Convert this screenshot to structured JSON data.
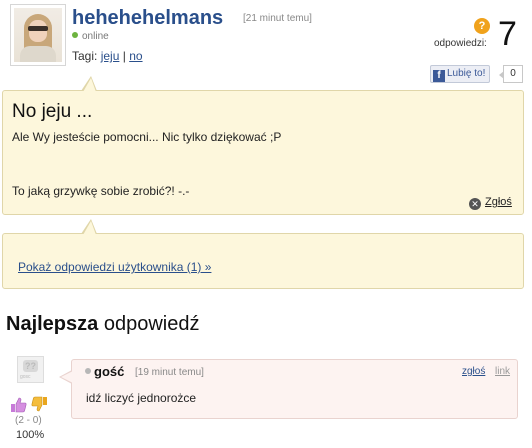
{
  "question": {
    "username": "hehehehelmans",
    "time": "[21 minut temu]",
    "status": "online",
    "tags_label": "Tagi:",
    "tags": [
      "jeju",
      "no"
    ],
    "tags_sep": " | ",
    "answers_label": "odpowiedzi:",
    "answers_count": "7",
    "q_icon": "?",
    "fb_like_label": "Lubię to!",
    "fb_like_count": "0",
    "title": "No jeju ...",
    "line1": "Ale Wy jesteście pomocni... Nic tylko dziękować ;P",
    "line2": "To jaką grzywkę sobie zrobić?! -.-",
    "report_label": "Zgłoś"
  },
  "user_answers": {
    "link_label": "Pokaż odpowiedzi użytkownika (1) »"
  },
  "best_answer": {
    "heading_bold": "Najlepsza",
    "heading_rest": " odpowiedź",
    "author": "gość",
    "time": "[19 minut temu]",
    "report_label": "zgłoś",
    "link_label": "link",
    "text": "idź liczyć jednorożce",
    "votes": "(2 - 0)",
    "percent": "100%"
  },
  "colors": {
    "accent": "#2a4f8b",
    "question_bg": "#fdf7dc",
    "answer_bg": "#fdf3f1",
    "online": "#6db33f",
    "question_icon": "#f0a21c"
  },
  "icons": {
    "question_mark": "question-mark-icon",
    "report": "close-circle-icon",
    "thumbs_up": "thumbs-up-icon",
    "thumbs_down": "thumbs-down-icon",
    "facebook": "facebook-icon"
  }
}
